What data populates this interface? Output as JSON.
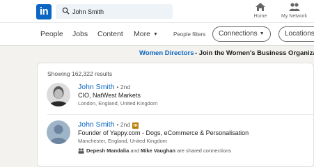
{
  "logo": {
    "text": "in"
  },
  "search": {
    "value": "John Smith"
  },
  "nav": {
    "home_label": "Home",
    "network_label": "My Network"
  },
  "filters": {
    "tabs": [
      "People",
      "Jobs",
      "Content",
      "More"
    ],
    "people_filters_label": "People filters",
    "connections_label": "Connections",
    "locations_label": "Locations"
  },
  "promo": {
    "link": "Women Directors",
    "text": "- Join the Women's Business Organization"
  },
  "results": {
    "showing": "Showing 162,322 results",
    "items": [
      {
        "name": "John Smith",
        "degree": "• 2nd",
        "headline": "CIO, NatWest Markets",
        "location": "London, England, United Kingdom"
      },
      {
        "name": "John Smith",
        "degree": "• 2nd",
        "badge": "in",
        "headline": "Founder of Yappy.com - Dogs, eCommerce & Personalisation",
        "location": "Manchester, England, United Kingdom",
        "shared_a": "Depesh Mandalia",
        "shared_and": "and",
        "shared_b": "Mike Vaughan",
        "shared_suffix": "are shared connections"
      }
    ]
  },
  "colors": {
    "brand": "#0a66c2",
    "background": "#f3f2ef",
    "badge": "#b57c00"
  }
}
